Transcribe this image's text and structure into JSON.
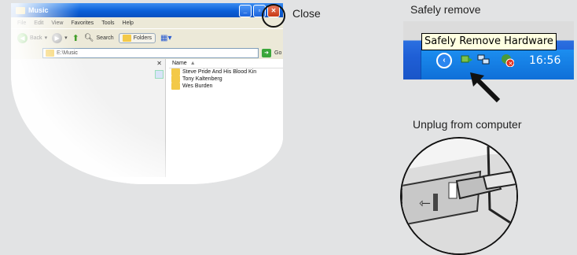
{
  "explorer": {
    "title": "Music",
    "menu": [
      "File",
      "Edit",
      "View",
      "Favorites",
      "Tools",
      "Help"
    ],
    "toolbar": {
      "back": "Back",
      "search": "Search",
      "folders": "Folders"
    },
    "address": "E:\\Music",
    "go": "Go",
    "column_name": "Name",
    "files": [
      "Steve Pride And His Blood Kin",
      "Tony Kaltenberg",
      "Wes Burden"
    ]
  },
  "callouts": {
    "close": "Close",
    "safely_remove": "Safely remove",
    "unplug": "Unplug from computer"
  },
  "taskbar": {
    "tooltip": "Safely Remove Hardware",
    "time": "16:56"
  },
  "colors": {
    "xp_blue": "#0a5fd8",
    "tooltip_bg": "#ffffe1",
    "background": "#e2e3e4"
  }
}
